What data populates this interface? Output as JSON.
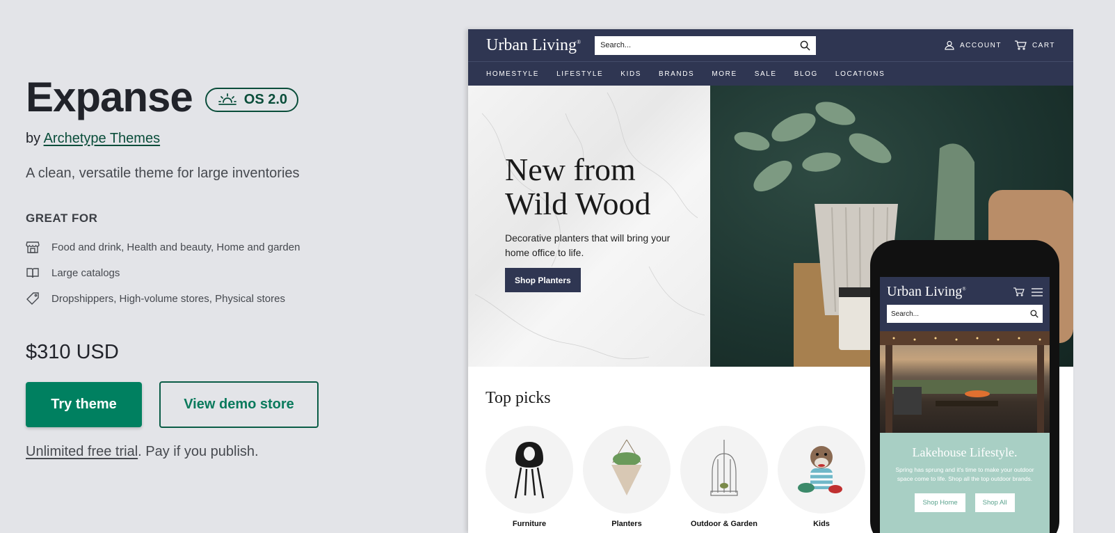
{
  "theme": {
    "name": "Expanse",
    "badge": "OS 2.0",
    "by_prefix": "by",
    "author": "Archetype Themes",
    "tagline": "A clean, versatile theme for large inventories"
  },
  "great_for": {
    "heading": "GREAT FOR",
    "items": [
      {
        "icon": "store-icon",
        "text": "Food and drink, Health and beauty, Home and garden"
      },
      {
        "icon": "book-icon",
        "text": "Large catalogs"
      },
      {
        "icon": "tag-icon",
        "text": "Dropshippers, High-volume stores, Physical stores"
      }
    ]
  },
  "pricing": {
    "price": "$310 USD",
    "try_label": "Try theme",
    "demo_label": "View demo store",
    "trial_link": "Unlimited free trial",
    "trial_suffix": ". Pay if you publish."
  },
  "desktop_preview": {
    "logo": "Urban Living",
    "logo_mark": "®",
    "search_placeholder": "Search...",
    "account_label": "ACCOUNT",
    "cart_label": "CART",
    "nav": [
      "HOMESTYLE",
      "LIFESTYLE",
      "KIDS",
      "BRANDS",
      "MORE",
      "SALE",
      "BLOG",
      "LOCATIONS"
    ],
    "hero": {
      "heading": "New from Wild Wood",
      "text": "Decorative planters that will bring your home office to life.",
      "button": "Shop Planters"
    },
    "top_picks_title": "Top picks",
    "top_picks": [
      "Furniture",
      "Planters",
      "Outdoor & Garden",
      "Kids"
    ]
  },
  "mobile_preview": {
    "logo": "Urban Living",
    "logo_mark": "®",
    "search_placeholder": "Search...",
    "promo_heading": "Lakehouse Lifestyle.",
    "promo_text": "Spring has sprung and it's time to make your outdoor space come to life. Shop all the top outdoor brands.",
    "btn_home": "Shop Home",
    "btn_all": "Shop All"
  },
  "colors": {
    "brand_green": "#008060",
    "badge_green": "#0a4d3a",
    "store_navy": "#2f3652",
    "promo_mint": "#a8cfc4",
    "page_bg": "#e3e4e8"
  }
}
